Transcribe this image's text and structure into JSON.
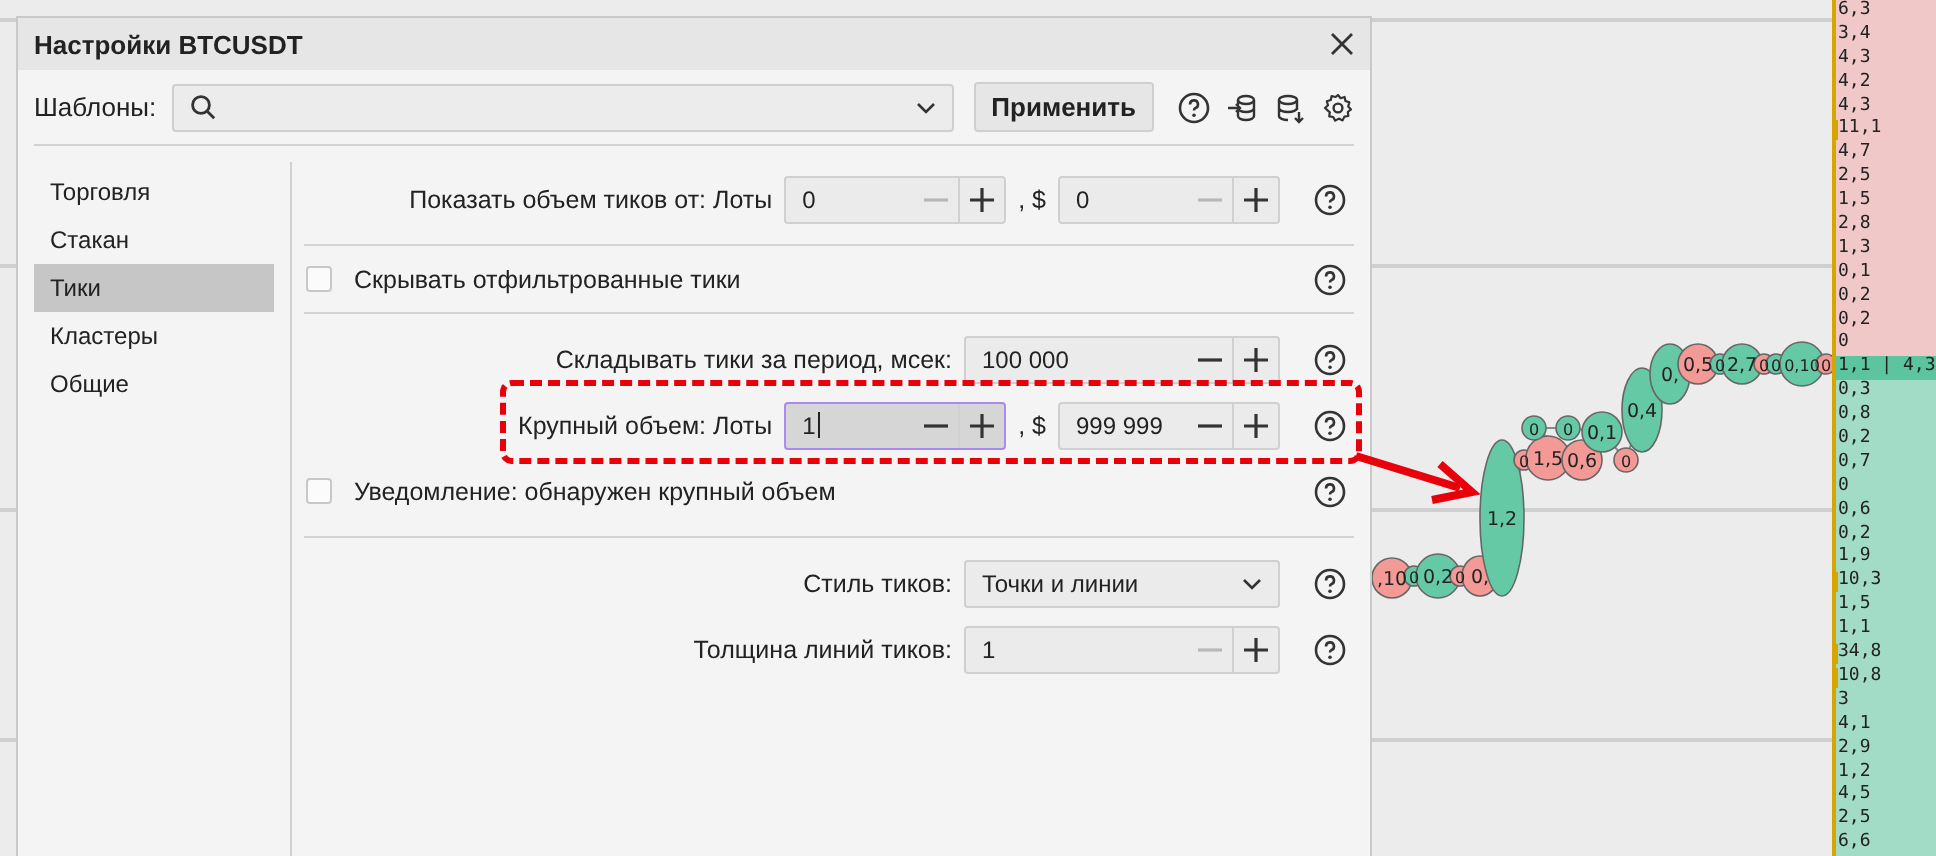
{
  "window": {
    "title": "Настройки BTCUSDT"
  },
  "templates": {
    "label": "Шаблоны:",
    "apply_button": "Применить"
  },
  "sidebar": {
    "items": [
      {
        "label": "Торговля",
        "selected": false
      },
      {
        "label": "Стакан",
        "selected": false
      },
      {
        "label": "Тики",
        "selected": true
      },
      {
        "label": "Кластеры",
        "selected": false
      },
      {
        "label": "Общие",
        "selected": false
      }
    ]
  },
  "sections": [
    {
      "rows": [
        {
          "kind": "spin_pair",
          "label": "Показать объем тиков от: Лоты",
          "fields": [
            {
              "value": "0",
              "minus_disabled": true,
              "focused": false
            },
            {
              "prefix": ", $",
              "value": "0",
              "minus_disabled": true,
              "focused": false
            }
          ]
        }
      ]
    },
    {
      "rows": [
        {
          "kind": "checkbox",
          "label": "Скрывать отфильтрованные тики",
          "checked": false
        }
      ]
    },
    {
      "rows": [
        {
          "kind": "spin",
          "label": "Складывать тики за период, мсек:",
          "fields": [
            {
              "value": "100 000",
              "minus_disabled": false,
              "focused": false
            }
          ]
        },
        {
          "kind": "spin_pair",
          "label": "Крупный объем: Лоты",
          "highlighted": true,
          "fields": [
            {
              "value": "1",
              "minus_disabled": false,
              "focused": true
            },
            {
              "prefix": ", $",
              "value": "999 999",
              "minus_disabled": false,
              "focused": false
            }
          ]
        },
        {
          "kind": "checkbox",
          "label": "Уведомление: обнаружен крупный объем",
          "checked": false
        }
      ]
    },
    {
      "rows": [
        {
          "kind": "select",
          "label": "Стиль тиков:",
          "value": "Точки и линии"
        },
        {
          "kind": "spin",
          "label": "Толщина линий тиков:",
          "fields": [
            {
              "value": "1",
              "minus_disabled": true,
              "focused": false
            }
          ]
        }
      ]
    }
  ],
  "ticks": [
    {
      "label": ",10",
      "color": "#f49a96"
    },
    {
      "label": "0",
      "color": "#66c9a6"
    },
    {
      "label": "0,2",
      "color": "#66c9a6"
    },
    {
      "label": "0",
      "color": "#f49a96"
    },
    {
      "label": "0,",
      "color": "#f49a96"
    },
    {
      "label": "1,2",
      "color": "#66c9a6"
    },
    {
      "label": "0",
      "color": "#f49a96"
    },
    {
      "label": "1,5",
      "color": "#f49a96"
    },
    {
      "label": "0,6",
      "color": "#f49a96"
    },
    {
      "label": "0",
      "color": "#66c9a6"
    },
    {
      "label": "0",
      "color": "#66c9a6"
    },
    {
      "label": "0,1",
      "color": "#66c9a6"
    },
    {
      "label": "0",
      "color": "#f49a96"
    },
    {
      "label": "0,4",
      "color": "#66c9a6"
    },
    {
      "label": "0,",
      "color": "#66c9a6"
    },
    {
      "label": "0,5",
      "color": "#f49a96"
    },
    {
      "label": "0",
      "color": "#66c9a6"
    },
    {
      "label": "2,7",
      "color": "#66c9a6"
    },
    {
      "label": "0",
      "color": "#f49a96"
    },
    {
      "label": "0",
      "color": "#66c9a6"
    },
    {
      "label": "0,10",
      "color": "#66c9a6"
    },
    {
      "label": "0",
      "color": "#f49a96"
    }
  ],
  "ladder": [
    {
      "value": "6,3",
      "kind": "sell",
      "large": false
    },
    {
      "value": "3,4",
      "kind": "sell",
      "large": false
    },
    {
      "value": "4,3",
      "kind": "sell",
      "large": false
    },
    {
      "value": "4,2",
      "kind": "sell",
      "large": false
    },
    {
      "value": "4,3",
      "kind": "sell",
      "large": false
    },
    {
      "value": "11,1",
      "kind": "sell",
      "large": true
    },
    {
      "value": "4,7",
      "kind": "sell",
      "large": false
    },
    {
      "value": "2,5",
      "kind": "sell",
      "large": false
    },
    {
      "value": "1,5",
      "kind": "sell",
      "large": false
    },
    {
      "value": "2,8",
      "kind": "sell",
      "large": false
    },
    {
      "value": "1,3",
      "kind": "sell",
      "large": false
    },
    {
      "value": "0,1",
      "kind": "sell",
      "large": false
    },
    {
      "value": "0,2",
      "kind": "sell",
      "large": false
    },
    {
      "value": "0,2",
      "kind": "sell",
      "large": false
    },
    {
      "value": "0",
      "kind": "sell",
      "large": false
    },
    {
      "value": "1,1 | 4,3",
      "kind": "current",
      "large": false
    },
    {
      "value": "0,3",
      "kind": "buy",
      "large": false
    },
    {
      "value": "0,8",
      "kind": "buy",
      "large": false
    },
    {
      "value": "0,2",
      "kind": "buy",
      "large": false
    },
    {
      "value": "0,7",
      "kind": "buy",
      "large": false
    },
    {
      "value": "0",
      "kind": "buy",
      "large": false
    },
    {
      "value": "0,6",
      "kind": "buy",
      "large": false
    },
    {
      "value": "0,2",
      "kind": "buy",
      "large": false
    },
    {
      "value": "1,9",
      "kind": "buy",
      "large": false
    },
    {
      "value": "10,3",
      "kind": "buy",
      "large": true
    },
    {
      "value": "1,5",
      "kind": "buy",
      "large": false
    },
    {
      "value": "1,1",
      "kind": "buy",
      "large": false
    },
    {
      "value": "34,8",
      "kind": "buy",
      "large": true
    },
    {
      "value": "10,8",
      "kind": "buy",
      "large": true
    },
    {
      "value": "3",
      "kind": "buy",
      "large": false
    },
    {
      "value": "4,1",
      "kind": "buy",
      "large": false
    },
    {
      "value": "2,9",
      "kind": "buy",
      "large": false
    },
    {
      "value": "1,2",
      "kind": "buy",
      "large": false
    },
    {
      "value": "4,5",
      "kind": "buy",
      "large": false
    },
    {
      "value": "2,5",
      "kind": "buy",
      "large": false
    },
    {
      "value": "6,6",
      "kind": "buy",
      "large": false
    }
  ]
}
